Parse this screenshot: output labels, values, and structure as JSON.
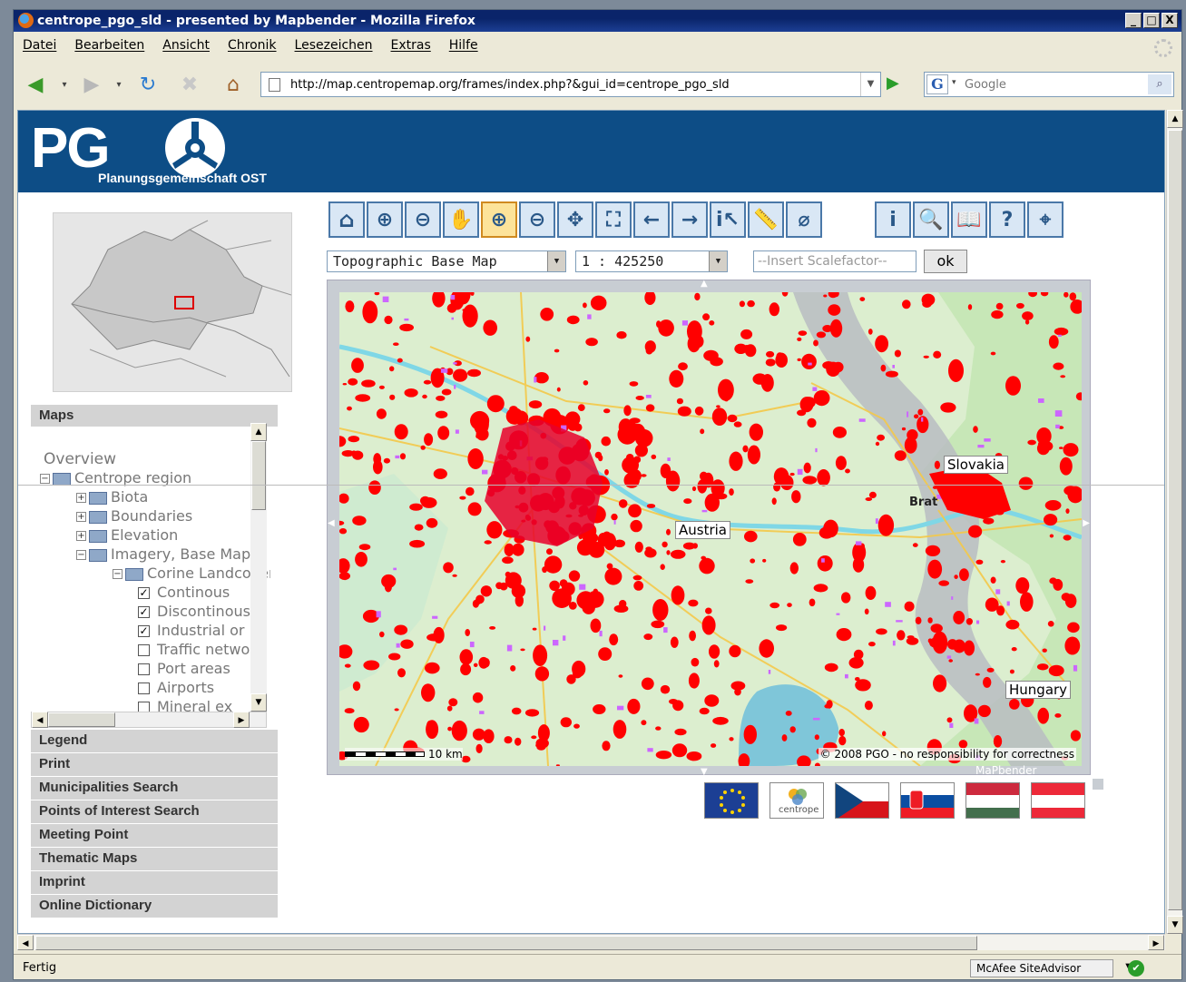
{
  "window": {
    "title": "centrope_pgo_sld - presented by Mapbender - Mozilla Firefox",
    "controls": [
      "_",
      "□",
      "X"
    ]
  },
  "menubar": [
    "Datei",
    "Bearbeiten",
    "Ansicht",
    "Chronik",
    "Lesezeichen",
    "Extras",
    "Hilfe"
  ],
  "navbar": {
    "url": "http://map.centropemap.org/frames/index.php?&gui_id=centrope_pgo_sld",
    "search_placeholder": "Google",
    "search_engine_letter": "G"
  },
  "header": {
    "logo_text": "PG",
    "logo_subtitle": "Planungsgemeinschaft OST"
  },
  "left_panel": {
    "maps_heading": "Maps",
    "tree": [
      {
        "label": "Overview",
        "level": 0,
        "type": "heading"
      },
      {
        "label": "Centrope region",
        "level": 0,
        "type": "folder",
        "expander": "−"
      },
      {
        "label": "Biota",
        "level": 1,
        "type": "folder",
        "expander": "+"
      },
      {
        "label": "Boundaries",
        "level": 1,
        "type": "folder",
        "expander": "+"
      },
      {
        "label": "Elevation",
        "level": 1,
        "type": "folder",
        "expander": "+"
      },
      {
        "label": "Imagery, Base Map",
        "level": 1,
        "type": "folder",
        "expander": "−"
      },
      {
        "label": "Corine Landcover",
        "level": 2,
        "type": "folder",
        "expander": "−"
      },
      {
        "label": "Continous",
        "level": 3,
        "type": "checkbox",
        "checked": true
      },
      {
        "label": "Discontinous",
        "level": 3,
        "type": "checkbox",
        "checked": true
      },
      {
        "label": "Industrial or",
        "level": 3,
        "type": "checkbox",
        "checked": true
      },
      {
        "label": "Traffic network",
        "level": 3,
        "type": "checkbox",
        "checked": false
      },
      {
        "label": "Port areas",
        "level": 3,
        "type": "checkbox",
        "checked": false
      },
      {
        "label": "Airports",
        "level": 3,
        "type": "checkbox",
        "checked": false
      },
      {
        "label": "Mineral ex",
        "level": 3,
        "type": "checkbox",
        "checked": false
      }
    ],
    "menu": [
      "Legend",
      "Print",
      "Municipalities Search",
      "Points of Interest Search",
      "Meeting Point",
      "Thematic Maps",
      "Imprint",
      "Online Dictionary"
    ]
  },
  "toolbar": {
    "tools": [
      {
        "name": "home-tool",
        "glyph": "⌂"
      },
      {
        "name": "zoom-in-tool",
        "glyph": "⊕"
      },
      {
        "name": "zoom-out-tool",
        "glyph": "⊖"
      },
      {
        "name": "pan-tool",
        "glyph": "✋"
      },
      {
        "name": "zoom-box-tool",
        "glyph": "⊕",
        "active": true
      },
      {
        "name": "zoom-out-box-tool",
        "glyph": "⊖"
      },
      {
        "name": "zoom-extent-tool",
        "glyph": "✥"
      },
      {
        "name": "full-view-tool",
        "glyph": "⛶"
      },
      {
        "name": "back-tool",
        "glyph": "←"
      },
      {
        "name": "forward-tool",
        "glyph": "→"
      },
      {
        "name": "feature-info-tool",
        "glyph": "i↖"
      },
      {
        "name": "measure-tool",
        "glyph": "📏"
      },
      {
        "name": "clear-tool",
        "glyph": "⌀"
      }
    ],
    "tools_right": [
      {
        "name": "wms-info-tool",
        "glyph": "i"
      },
      {
        "name": "sql-search-tool",
        "glyph": "🔍"
      },
      {
        "name": "dictionary-tool",
        "glyph": "📖"
      },
      {
        "name": "help-tool",
        "glyph": "?"
      },
      {
        "name": "coordinates-tool",
        "glyph": "⌖"
      }
    ]
  },
  "controls": {
    "basemap_select": "Topographic Base Map",
    "scale_select": "1 : 425250",
    "scale_placeholder": "--Insert Scalefactor--",
    "ok_label": "ok"
  },
  "map": {
    "labels": {
      "austria": "Austria",
      "slovakia": "Slovakia",
      "hungary": "Hungary",
      "bratislava": "Brat"
    },
    "scalebar_label": "10 km",
    "copyright": "© 2008 PGO - no responsibility for correctness",
    "mapbender_credit": "MaPbender"
  },
  "flags": [
    "eu-flag",
    "centrope-logo",
    "czech-flag",
    "slovak-flag",
    "hungarian-flag",
    "austrian-flag"
  ],
  "flag_labels": {
    "centrope": "centrope"
  },
  "status": {
    "text": "Fertig",
    "mcafee_label": "McAfee SiteAdvisor"
  },
  "colors": {
    "header_bg": "#0d4d86",
    "urban_red": "#ff0000",
    "industrial_purple": "#cc66ff",
    "active_tool": "#fde39a"
  }
}
